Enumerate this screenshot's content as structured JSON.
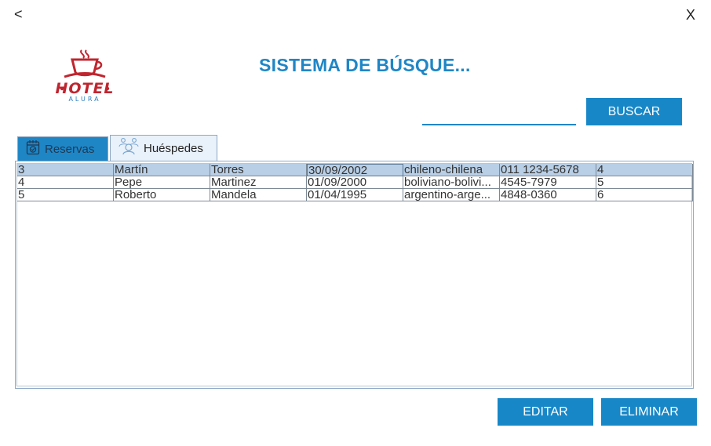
{
  "window": {
    "back_label": "<",
    "close_label": "X"
  },
  "logo": {
    "name": "HOTEL",
    "sub": "ALURA",
    "icon": "coffee-cup-icon",
    "brand_red": "#c0252f",
    "brand_blue": "#2d7fbf"
  },
  "header": {
    "title": "SISTEMA DE BÚSQUE..."
  },
  "search": {
    "value": "",
    "placeholder": "",
    "button_label": "BUSCAR"
  },
  "tabs": [
    {
      "label": "Reservas",
      "icon": "calendar-check-icon",
      "active": false
    },
    {
      "label": "Huéspedes",
      "icon": "guests-icon",
      "active": true
    }
  ],
  "table": {
    "rows": [
      {
        "id": "3",
        "nombre": "Martín",
        "apellido": "Torres",
        "fecha": "30/09/2002",
        "nacionalidad": "chileno-chilena",
        "telefono": "011 1234-5678",
        "reserva": "4",
        "selected": true
      },
      {
        "id": "4",
        "nombre": "Pepe",
        "apellido": "Martinez",
        "fecha": "01/09/2000",
        "nacionalidad": "boliviano-bolivi...",
        "telefono": "4545-7979",
        "reserva": "5",
        "selected": false
      },
      {
        "id": "5",
        "nombre": "Roberto",
        "apellido": "Mandela",
        "fecha": "01/04/1995",
        "nacionalidad": "argentino-arge...",
        "telefono": "4848-0360",
        "reserva": "6",
        "selected": false
      }
    ]
  },
  "actions": {
    "edit_label": "EDITAR",
    "delete_label": "ELIMINAR"
  },
  "colors": {
    "accent": "#1787c7",
    "selected_row": "#b8cfe6"
  }
}
